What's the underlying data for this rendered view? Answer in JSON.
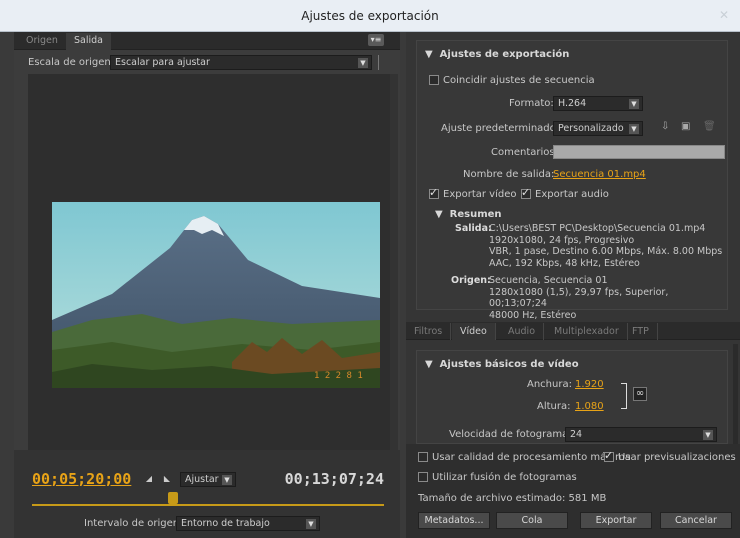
{
  "window": {
    "title": "Ajustes de exportación",
    "close_glyph": "✕"
  },
  "left": {
    "tabs": [
      "Origen",
      "Salida"
    ],
    "panel_menu_glyph": "▾≡",
    "scale_label": "Escala de origen:",
    "scale_value": "Escalar para ajustar",
    "timecode_in": "00;05;20;00",
    "fit_value": "Ajustar",
    "timecode_out": "00;13;07;24",
    "range_label": "Intervalo de origen:",
    "range_value": "Entorno de trabajo"
  },
  "export": {
    "section_title": "Ajustes de exportación",
    "match_sequence": "Coincidir ajustes de secuencia",
    "format_label": "Formato:",
    "format_value": "H.264",
    "preset_label": "Ajuste predeterminado:",
    "preset_value": "Personalizado",
    "comments_label": "Comentarios:",
    "comments_value": "",
    "output_label": "Nombre de salida:",
    "output_value": "Secuencia 01.mp4",
    "export_video": "Exportar vídeo",
    "export_audio": "Exportar audio",
    "summary_title": "Resumen",
    "summary_out_label": "Salida:",
    "summary_out": [
      "C:\\Users\\BEST PC\\Desktop\\Secuencia 01.mp4",
      "1920x1080, 24 fps, Progresivo",
      "VBR, 1 pase, Destino 6.00 Mbps, Máx. 8.00 Mbps",
      "AAC, 192 Kbps, 48 kHz, Estéreo"
    ],
    "summary_src_label": "Origen:",
    "summary_src": [
      "Secuencia, Secuencia 01",
      "1280x1080 (1,5), 29,97 fps, Superior, 00;13;07;24",
      "48000 Hz, Estéreo"
    ]
  },
  "tabs2": [
    "Filtros",
    "Vídeo",
    "Audio",
    "Multiplexador",
    "FTP"
  ],
  "video": {
    "section_title": "Ajustes básicos de vídeo",
    "width_label": "Anchura:",
    "width_value": "1.920",
    "height_label": "Altura:",
    "height_value": "1.080",
    "fps_label": "Velocidad de fotograma:",
    "fps_value": "24"
  },
  "bottom": {
    "max_quality": "Usar calidad de procesamiento máxima",
    "use_previews": "Usar previsualizaciones",
    "frame_blend": "Utilizar fusión de fotogramas",
    "filesize": "Tamaño de archivo estimado: 581 MB",
    "buttons": [
      "Metadatos...",
      "Cola",
      "Exportar",
      "Cancelar"
    ]
  }
}
